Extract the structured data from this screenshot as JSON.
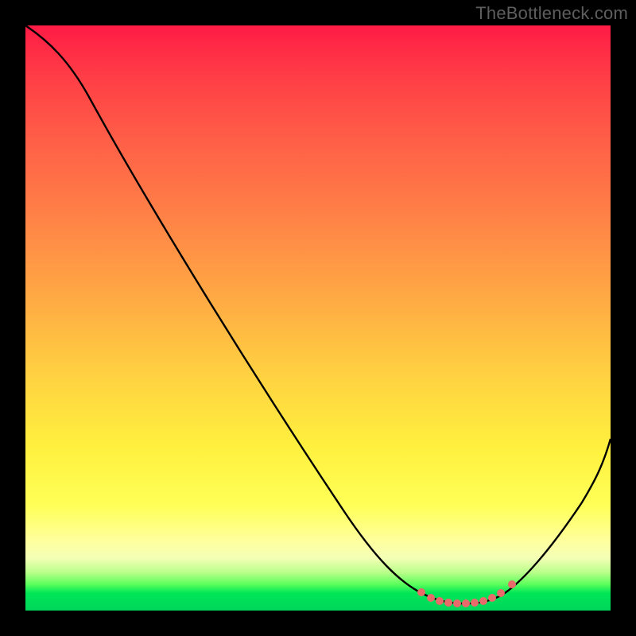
{
  "watermark": "TheBottleneck.com",
  "chart_data": {
    "type": "line",
    "title": "",
    "xlabel": "",
    "ylabel": "",
    "xlim": [
      0,
      100
    ],
    "ylim": [
      0,
      100
    ],
    "series": [
      {
        "name": "bottleneck-curve",
        "x": [
          0,
          6,
          12,
          18,
          24,
          30,
          36,
          42,
          48,
          54,
          60,
          64,
          68,
          70,
          72,
          74,
          76,
          78,
          80,
          82,
          84,
          88,
          92,
          96,
          100
        ],
        "y": [
          100,
          97,
          93,
          86,
          78,
          70,
          61,
          52,
          43,
          34,
          24,
          15,
          7,
          4,
          2,
          1,
          1,
          1,
          1,
          2,
          4,
          9,
          15,
          22,
          30
        ]
      }
    ],
    "markers": {
      "name": "optimal-range-dots",
      "color": "#e86a6a",
      "x": [
        68,
        70,
        71.5,
        73,
        74.5,
        76,
        77.5,
        79,
        80.5,
        82,
        84
      ],
      "y": [
        4.5,
        3,
        2.3,
        1.8,
        1.5,
        1.4,
        1.5,
        1.8,
        2.3,
        3.2,
        5
      ]
    },
    "gradient_stops": [
      {
        "pos": 0.0,
        "color": "#ff1b45"
      },
      {
        "pos": 0.3,
        "color": "#ff7a47"
      },
      {
        "pos": 0.6,
        "color": "#ffd241"
      },
      {
        "pos": 0.82,
        "color": "#ffff57"
      },
      {
        "pos": 0.91,
        "color": "#f4ffb5"
      },
      {
        "pos": 0.97,
        "color": "#00e657"
      },
      {
        "pos": 1.0,
        "color": "#00d65a"
      }
    ]
  }
}
